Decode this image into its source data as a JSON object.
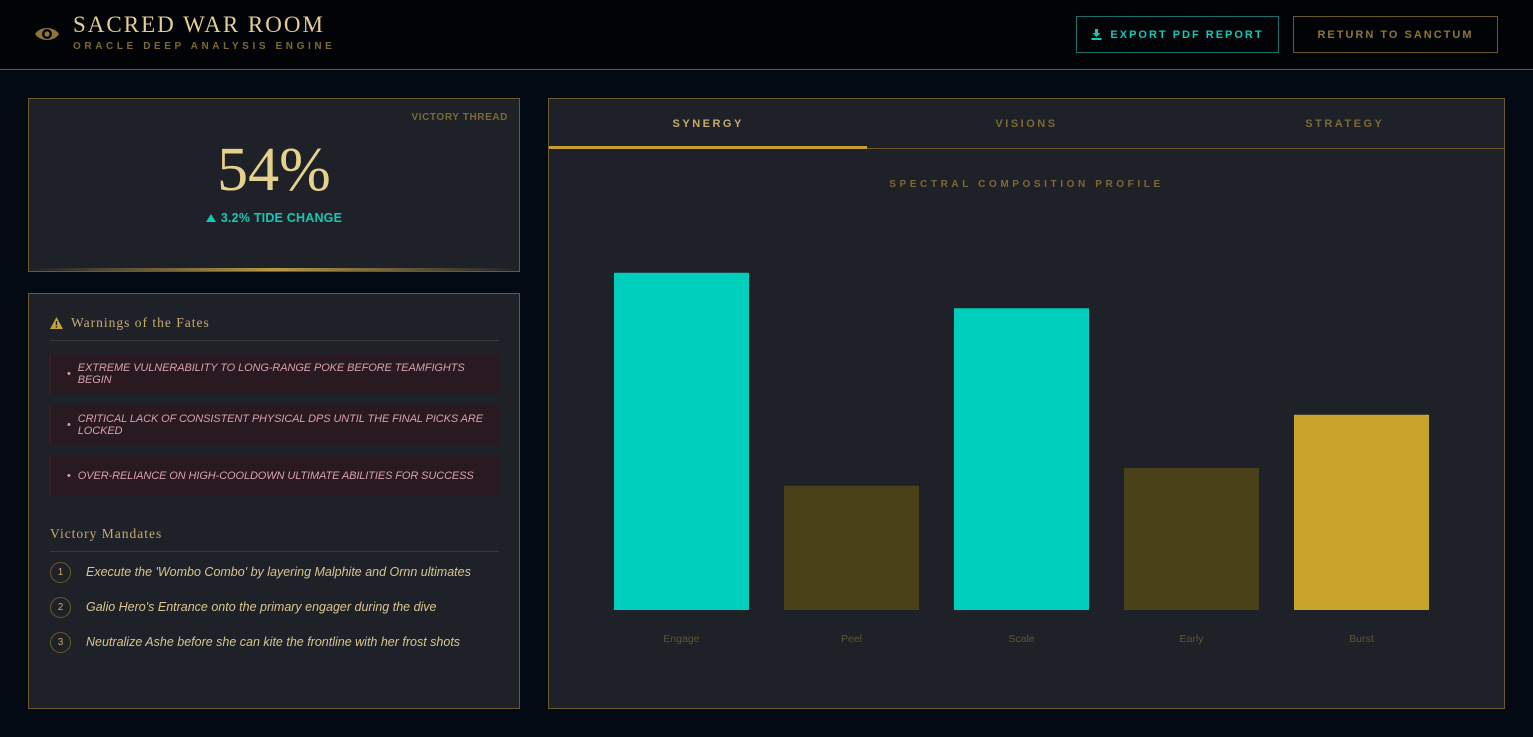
{
  "header": {
    "title": "SACRED WAR ROOM",
    "subtitle": "ORACLE DEEP ANALYSIS ENGINE",
    "export_button": "EXPORT PDF REPORT",
    "return_button": "RETURN TO SANCTUM"
  },
  "victory": {
    "label": "VICTORY THREAD",
    "value": "54%",
    "tide_change": "3.2% TIDE CHANGE"
  },
  "warnings": {
    "title": "Warnings of the Fates",
    "items": [
      "EXTREME VULNERABILITY TO LONG-RANGE POKE BEFORE TEAMFIGHTS BEGIN",
      "CRITICAL LACK OF CONSISTENT PHYSICAL DPS UNTIL THE FINAL PICKS ARE LOCKED",
      "OVER-RELIANCE ON HIGH-COOLDOWN ULTIMATE ABILITIES FOR SUCCESS"
    ]
  },
  "mandates": {
    "title": "Victory Mandates",
    "items": [
      {
        "num": "1",
        "text": "Execute the 'Wombo Combo' by layering Malphite and Ornn ultimates"
      },
      {
        "num": "2",
        "text": "Galio Hero's Entrance onto the primary engager during the dive"
      },
      {
        "num": "3",
        "text": "Neutralize Ashe before she can kite the frontline with her frost shots"
      }
    ]
  },
  "tabs": [
    {
      "label": "SYNERGY",
      "active": true
    },
    {
      "label": "VISIONS",
      "active": false
    },
    {
      "label": "STRATEGY",
      "active": false
    }
  ],
  "colors": {
    "teal": "#00cfbe",
    "dim_gold": "#4a4119",
    "gold": "#c8a42c"
  },
  "chart_data": {
    "type": "bar",
    "title": "SPECTRAL COMPOSITION PROFILE",
    "categories": [
      "Engage",
      "Peel",
      "Scale",
      "Early",
      "Burst"
    ],
    "values": [
      95,
      35,
      85,
      40,
      55
    ],
    "bar_colors": [
      "#00cfbe",
      "#4a4119",
      "#00cfbe",
      "#4a4119",
      "#c8a42c"
    ],
    "ylim": [
      0,
      100
    ],
    "grid": false,
    "xlabel": "",
    "ylabel": ""
  }
}
